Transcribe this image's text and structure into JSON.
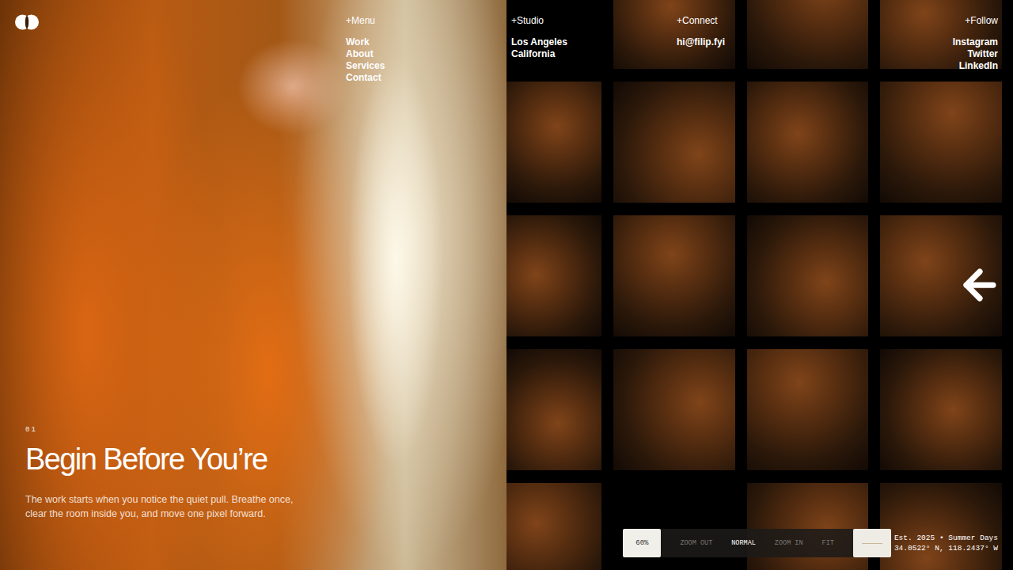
{
  "nav": {
    "columns": [
      {
        "heading": "+Menu",
        "align": "left",
        "items": [
          "Work",
          "About",
          "Services",
          "Contact"
        ]
      },
      {
        "heading": "+Studio",
        "align": "left",
        "items": [
          "Los Angeles",
          "California"
        ]
      },
      {
        "heading": "+Connect",
        "align": "left",
        "items": [
          "hi@filip.fyi"
        ]
      },
      {
        "heading": "+Follow",
        "align": "right",
        "items": [
          "Instagram",
          "Twitter",
          "LinkedIn"
        ]
      }
    ]
  },
  "hero": {
    "index": "01",
    "title": "Begin Before You’re",
    "body": "The work starts when you notice the quiet pull. Breathe once, clear the room inside you, and move one pixel forward."
  },
  "gallery": {
    "tiles": [
      {
        "empty": true
      },
      {
        "empty": false
      },
      {
        "empty": false
      },
      {
        "empty": false
      },
      {
        "empty": false
      },
      {
        "empty": false
      },
      {
        "empty": false
      },
      {
        "empty": false
      },
      {
        "empty": false
      },
      {
        "empty": false
      },
      {
        "empty": false
      },
      {
        "empty": false
      },
      {
        "empty": false
      },
      {
        "empty": false
      },
      {
        "empty": false
      },
      {
        "empty": false
      },
      {
        "empty": false
      },
      {
        "empty": true
      },
      {
        "empty": false
      },
      {
        "empty": false
      }
    ]
  },
  "zoom": {
    "reading": "60%",
    "options": [
      {
        "label": "ZOOM OUT",
        "selected": false
      },
      {
        "label": "NORMAL",
        "selected": true
      },
      {
        "label": "ZOOM IN",
        "selected": false
      },
      {
        "label": "FIT",
        "selected": false
      }
    ]
  },
  "caption": {
    "lines": [
      "Est. 2025 • Summer Days",
      "34.0522° N, 118.2437° W"
    ]
  }
}
